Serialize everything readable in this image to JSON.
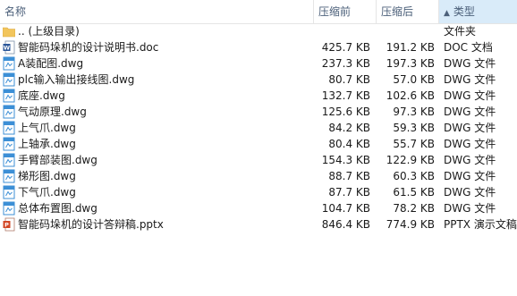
{
  "columns": {
    "name": "名称",
    "compressed": "压缩前",
    "original": "压缩后",
    "type": "类型",
    "sort_indicator": "▲"
  },
  "files": [
    {
      "icon": "folder-up-icon",
      "name": ".. (上级目录)",
      "compressed": "",
      "original": "",
      "type": "文件夹"
    },
    {
      "icon": "word-doc-icon",
      "name": "智能码垛机的设计说明书.doc",
      "compressed": "425.7 KB",
      "original": "191.2 KB",
      "type": "DOC 文档"
    },
    {
      "icon": "dwg-file-icon",
      "name": "A装配图.dwg",
      "compressed": "237.3 KB",
      "original": "197.3 KB",
      "type": "DWG 文件"
    },
    {
      "icon": "dwg-file-icon",
      "name": "plc输入输出接线图.dwg",
      "compressed": "80.7 KB",
      "original": "57.0 KB",
      "type": "DWG 文件"
    },
    {
      "icon": "dwg-file-icon",
      "name": "底座.dwg",
      "compressed": "132.7 KB",
      "original": "102.6 KB",
      "type": "DWG 文件"
    },
    {
      "icon": "dwg-file-icon",
      "name": "气动原理.dwg",
      "compressed": "125.6 KB",
      "original": "97.3 KB",
      "type": "DWG 文件"
    },
    {
      "icon": "dwg-file-icon",
      "name": "上气爪.dwg",
      "compressed": "84.2 KB",
      "original": "59.3 KB",
      "type": "DWG 文件"
    },
    {
      "icon": "dwg-file-icon",
      "name": "上轴承.dwg",
      "compressed": "80.4 KB",
      "original": "55.7 KB",
      "type": "DWG 文件"
    },
    {
      "icon": "dwg-file-icon",
      "name": "手臂部装图.dwg",
      "compressed": "154.3 KB",
      "original": "122.9 KB",
      "type": "DWG 文件"
    },
    {
      "icon": "dwg-file-icon",
      "name": "梯形图.dwg",
      "compressed": "88.7 KB",
      "original": "60.3 KB",
      "type": "DWG 文件"
    },
    {
      "icon": "dwg-file-icon",
      "name": "下气爪.dwg",
      "compressed": "87.7 KB",
      "original": "61.5 KB",
      "type": "DWG 文件"
    },
    {
      "icon": "dwg-file-icon",
      "name": "总体布置图.dwg",
      "compressed": "104.7 KB",
      "original": "78.2 KB",
      "type": "DWG 文件"
    },
    {
      "icon": "pptx-file-icon",
      "name": "智能码垛机的设计答辩稿.pptx",
      "compressed": "846.4 KB",
      "original": "774.9 KB",
      "type": "PPTX 演示文稿"
    }
  ],
  "colors": {
    "header_text": "#4c607a",
    "sorted_column_bg": "#d9ebf9",
    "folder": "#f2c55c",
    "word_blue": "#2b579a",
    "dwg_blue": "#3c8fd6",
    "pptx_orange": "#d24726"
  }
}
